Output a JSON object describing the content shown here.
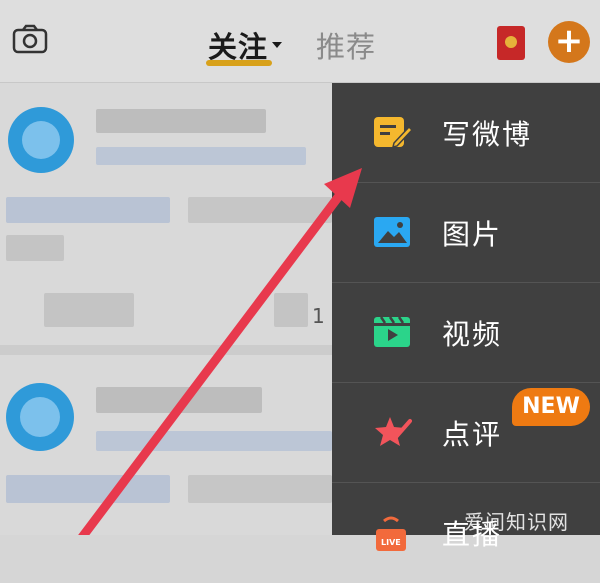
{
  "header": {
    "camera_icon": "camera-icon",
    "tab_follow": "关注",
    "tab_recommend": "推荐",
    "red_packet_icon": "red-packet-icon",
    "add_icon": "plus-icon",
    "add_symbol": "+"
  },
  "feed": {
    "count_text": "1"
  },
  "menu": {
    "items": [
      {
        "label": "写微博",
        "icon": "compose-icon",
        "color": "#f5b82e"
      },
      {
        "label": "图片",
        "icon": "image-icon",
        "color": "#2aa8f2"
      },
      {
        "label": "视频",
        "icon": "video-icon",
        "color": "#2bd48a"
      },
      {
        "label": "点评",
        "icon": "review-star-icon",
        "color": "#f2545b"
      },
      {
        "label": "直播",
        "icon": "live-icon",
        "color": "#f26a3c"
      }
    ],
    "new_badge": "NEW"
  },
  "watermark": "爱问知识网",
  "colors": {
    "accent_orange": "#d4771b",
    "arrow_red": "#e8394d",
    "menu_bg": "#404040"
  }
}
